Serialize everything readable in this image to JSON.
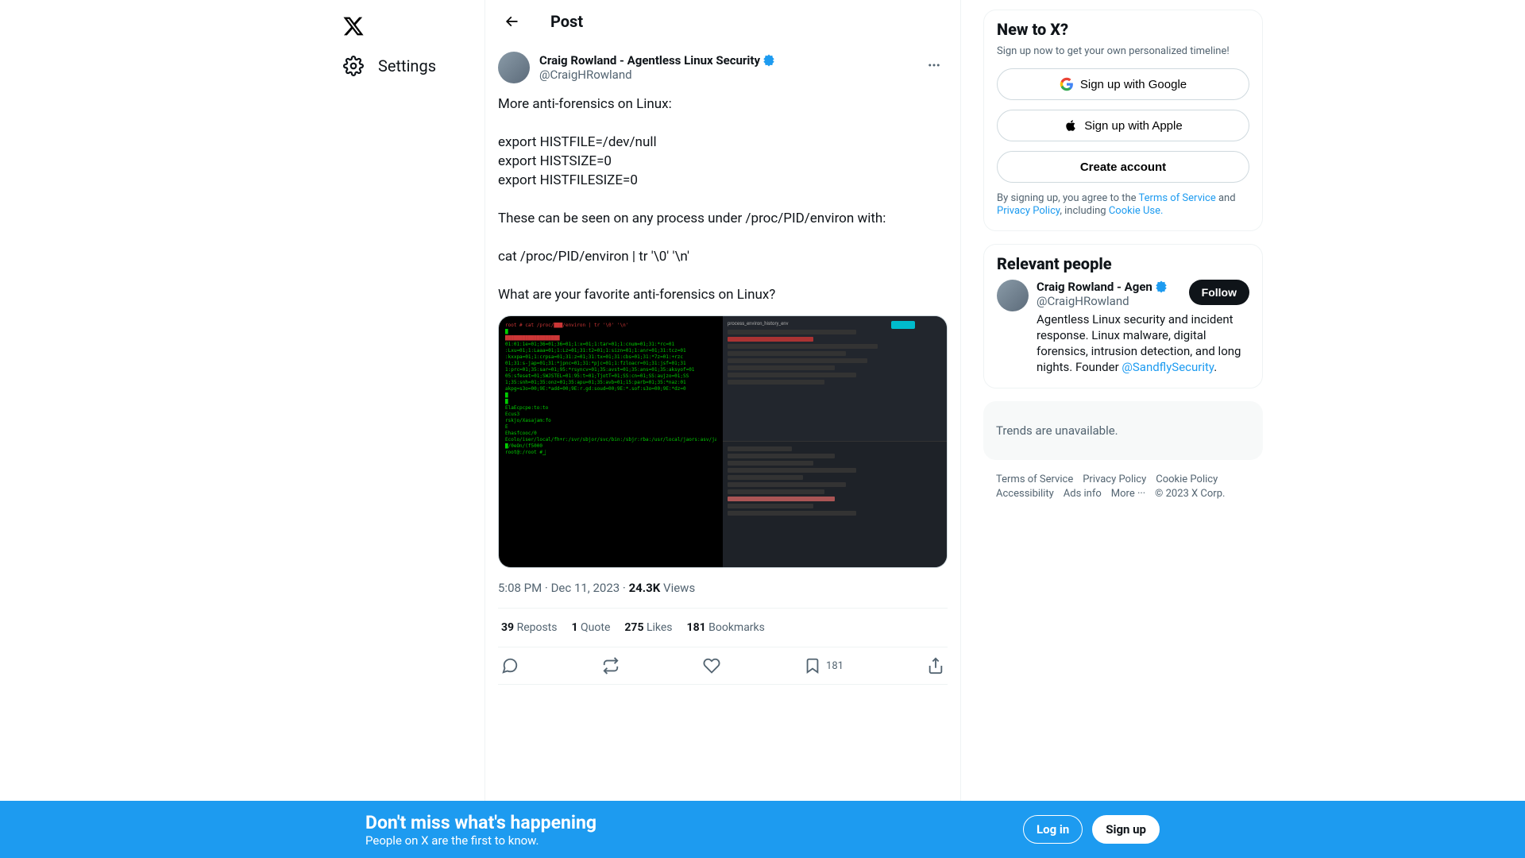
{
  "nav": {
    "settings": "Settings"
  },
  "header": {
    "title": "Post"
  },
  "post": {
    "author_name": "Craig Rowland - Agentless Linux Security",
    "author_handle": "@CraigHRowland",
    "body": "More anti-forensics on Linux:\n\nexport HISTFILE=/dev/null\nexport HISTSIZE=0\nexport HISTFILESIZE=0\n\nThese can be seen on any process under /proc/PID/environ with:\n\ncat /proc/PID/environ | tr '\\0' '\\n'\n\nWhat are your favorite anti-forensics on Linux?",
    "time": "5:08 PM",
    "date": "Dec 11, 2023",
    "views_count": "24.3K",
    "views_label": "Views",
    "reposts_count": "39",
    "reposts_label": "Reposts",
    "quotes_count": "1",
    "quotes_label": "Quote",
    "likes_count": "275",
    "likes_label": "Likes",
    "bookmarks_count": "181",
    "bookmarks_label": "Bookmarks",
    "bookmark_action_count": "181"
  },
  "signup": {
    "title": "New to X?",
    "subtitle": "Sign up now to get your own personalized timeline!",
    "google": "Sign up with Google",
    "apple": "Sign up with Apple",
    "create": "Create account",
    "legal_prefix": "By signing up, you agree to the ",
    "tos": "Terms of Service",
    "and": " and ",
    "privacy": "Privacy Policy",
    "including": ", including ",
    "cookie": "Cookie Use."
  },
  "relevant": {
    "title": "Relevant people",
    "name": "Craig Rowland - Agen",
    "handle": "@CraigHRowland",
    "follow": "Follow",
    "bio": "Agentless Linux security and incident response. Linux malware, digital forensics, intrusion detection, and long nights. Founder ",
    "bio_link": "@SandflySecurity",
    "bio_suffix": "."
  },
  "trends": {
    "unavailable": "Trends are unavailable."
  },
  "footer": {
    "tos": "Terms of Service",
    "privacy": "Privacy Policy",
    "cookie": "Cookie Policy",
    "accessibility": "Accessibility",
    "ads": "Ads info",
    "more": "More ···",
    "copyright": "© 2023 X Corp."
  },
  "banner": {
    "title": "Don't miss what's happening",
    "subtitle": "People on X are the first to know.",
    "login": "Log in",
    "signup": "Sign up"
  }
}
